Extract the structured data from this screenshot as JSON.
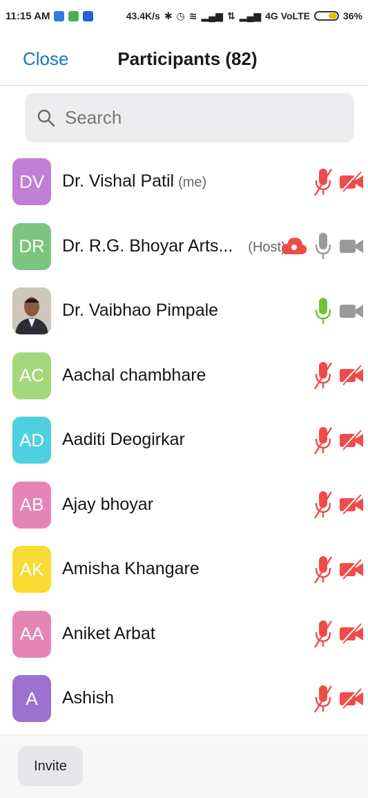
{
  "statusbar": {
    "time": "11:15 AM",
    "speed": "43.4K/s",
    "network": "4G VoLTE",
    "battery": "36%",
    "battery_level": 0.36
  },
  "header": {
    "close_label": "Close",
    "title": "Participants (82)"
  },
  "search": {
    "placeholder": "Search"
  },
  "participants": [
    {
      "initials": "DV",
      "color": "#c27ed6",
      "name": "Dr. Vishal Patil",
      "tag": "(me)",
      "mic": "muted",
      "video": "off",
      "photo": false
    },
    {
      "initials": "DR",
      "color": "#7cc47f",
      "name": "Dr. R.G. Bhoyar Arts...",
      "tag": "(Host)",
      "mic": "idle",
      "video": "on",
      "cloud": true,
      "photo": false
    },
    {
      "initials": "",
      "color": "#b8b0a4",
      "name": "Dr. Vaibhao Pimpale",
      "tag": "",
      "mic": "active",
      "video": "on",
      "photo": true
    },
    {
      "initials": "AC",
      "color": "#a4d87a",
      "name": "Aachal chambhare",
      "tag": "",
      "mic": "muted",
      "video": "off",
      "photo": false
    },
    {
      "initials": "AD",
      "color": "#4fd0de",
      "name": "Aaditi Deogirkar",
      "tag": "",
      "mic": "muted",
      "video": "off",
      "photo": false
    },
    {
      "initials": "AB",
      "color": "#e685b5",
      "name": "Ajay bhoyar",
      "tag": "",
      "mic": "muted",
      "video": "off",
      "photo": false
    },
    {
      "initials": "AK",
      "color": "#f7dc33",
      "name": "Amisha Khangare",
      "tag": "",
      "mic": "muted",
      "video": "off",
      "photo": false
    },
    {
      "initials": "AA",
      "color": "#e685b5",
      "name": "Aniket Arbat",
      "tag": "",
      "mic": "muted",
      "video": "off",
      "photo": false
    },
    {
      "initials": "A",
      "color": "#9b72d0",
      "name": "Ashish",
      "tag": "",
      "mic": "muted",
      "video": "off",
      "photo": false
    }
  ],
  "footer": {
    "invite_label": "Invite"
  },
  "colors": {
    "accent": "#1a73c8",
    "muted_red": "#f04b4b",
    "active_green": "#6cc43a",
    "idle_gray": "#9a9a9a"
  }
}
